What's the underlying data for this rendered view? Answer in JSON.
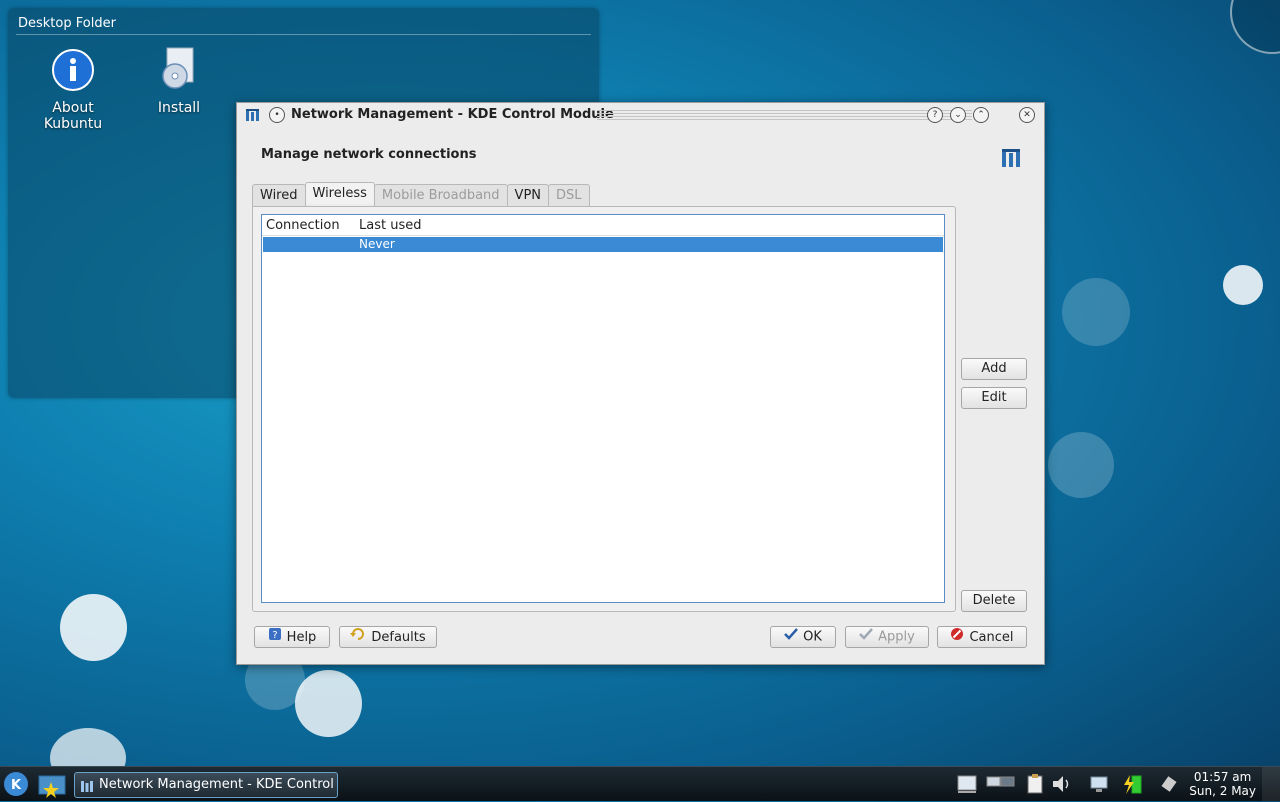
{
  "desktop": {
    "folder_title": "Desktop Folder",
    "icons": [
      {
        "label": "About Kubuntu"
      },
      {
        "label": "Install"
      }
    ]
  },
  "dialog": {
    "title": "Network Management - KDE Control Module",
    "heading": "Manage network connections",
    "tabs": [
      {
        "label": "Wired",
        "state": "normal"
      },
      {
        "label": "Wireless",
        "state": "active"
      },
      {
        "label": "Mobile Broadband",
        "state": "disabled"
      },
      {
        "label": "VPN",
        "state": "normal"
      },
      {
        "label": "DSL",
        "state": "disabled"
      }
    ],
    "list": {
      "columns": [
        "Connection",
        "Last used"
      ],
      "rows": [
        {
          "connection": "",
          "last_used": "Never"
        }
      ]
    },
    "side_buttons": {
      "add": "Add",
      "edit": "Edit",
      "delete": "Delete"
    },
    "bottom_buttons": {
      "help": "Help",
      "defaults": "Defaults",
      "ok": "OK",
      "apply": "Apply",
      "cancel": "Cancel"
    }
  },
  "taskbar": {
    "task_label": "Network Management - KDE Control M",
    "time": "01:57 am",
    "date": "Sun, 2 May"
  },
  "colors": {
    "selection": "#3a8ad6",
    "accent_border": "#5a8cc8"
  }
}
